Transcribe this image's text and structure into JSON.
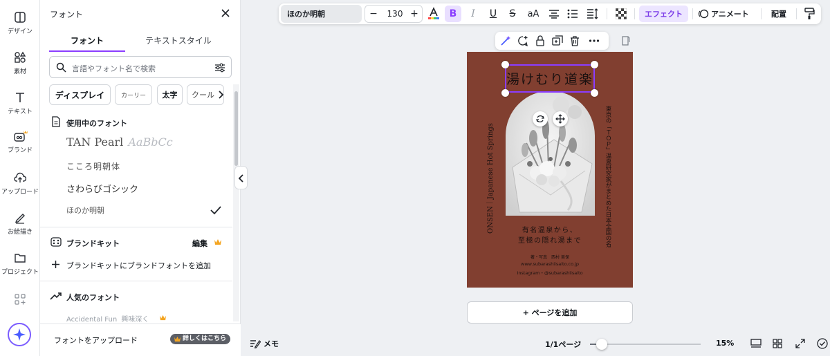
{
  "rail": {
    "items": [
      {
        "label": "デザイン",
        "icon": "layout-icon"
      },
      {
        "label": "素材",
        "icon": "elements-icon"
      },
      {
        "label": "テキスト",
        "icon": "text-icon"
      },
      {
        "label": "ブランド",
        "icon": "brand-icon"
      },
      {
        "label": "アップロード",
        "icon": "upload-icon"
      },
      {
        "label": "お絵描き",
        "icon": "draw-icon"
      },
      {
        "label": "プロジェクト",
        "icon": "folder-icon"
      }
    ]
  },
  "panel": {
    "title": "フォント",
    "tabs": [
      "フォント",
      "テキストスタイル"
    ],
    "search_placeholder": "言語やフォント名で検索",
    "chips": [
      "ディスプレイ",
      "カーリー",
      "太字",
      "クール"
    ],
    "in_use": {
      "heading": "使用中のフォント",
      "fonts": [
        "TAN Pearl",
        "AaBbCc",
        "こころ明朝体",
        "さわらびゴシック",
        "ほのか明朝"
      ]
    },
    "brand_kit": {
      "heading": "ブランドキット",
      "edit": "編集",
      "add": "ブランドキットにブランドフォントを追加"
    },
    "popular": {
      "heading": "人気のフォント",
      "first": "Accidental Fun",
      "first_suffix": "興味深く"
    },
    "upload_label": "フォントをアップロード",
    "upload_badge": "詳しくはこちら"
  },
  "toolbar": {
    "font_name": "ほのか明朝",
    "font_size": "130",
    "minus": "−",
    "plus": "+",
    "bold": "B",
    "italic": "I",
    "underline": "U",
    "strike": "S",
    "case": "aA",
    "effects": "エフェクト",
    "animate": "アニメート",
    "position": "配置"
  },
  "design": {
    "title": "湯けむり道楽",
    "side_left": "ONSEN｜Japanese Hot Springs",
    "side_right": "東京の「ＴＯＰ」温泉研究家がまとめた日本全国の名湯",
    "lead1": "有名温泉から、",
    "lead2": "至極の隠れ湯まで",
    "credit": "著・写真　西村 美保",
    "url": "www.subarashiisaito.co.jp",
    "instagram": "Instagram・@subarashiisaito"
  },
  "add_page": "+ ページを追加",
  "bottom": {
    "notes": "メモ",
    "pages": "1/1ページ",
    "zoom": "15%",
    "zoom_level": 0.15
  },
  "colors": {
    "accent": "#8b3dff",
    "page_bg": "#813f30",
    "crown": "#f4a521"
  }
}
